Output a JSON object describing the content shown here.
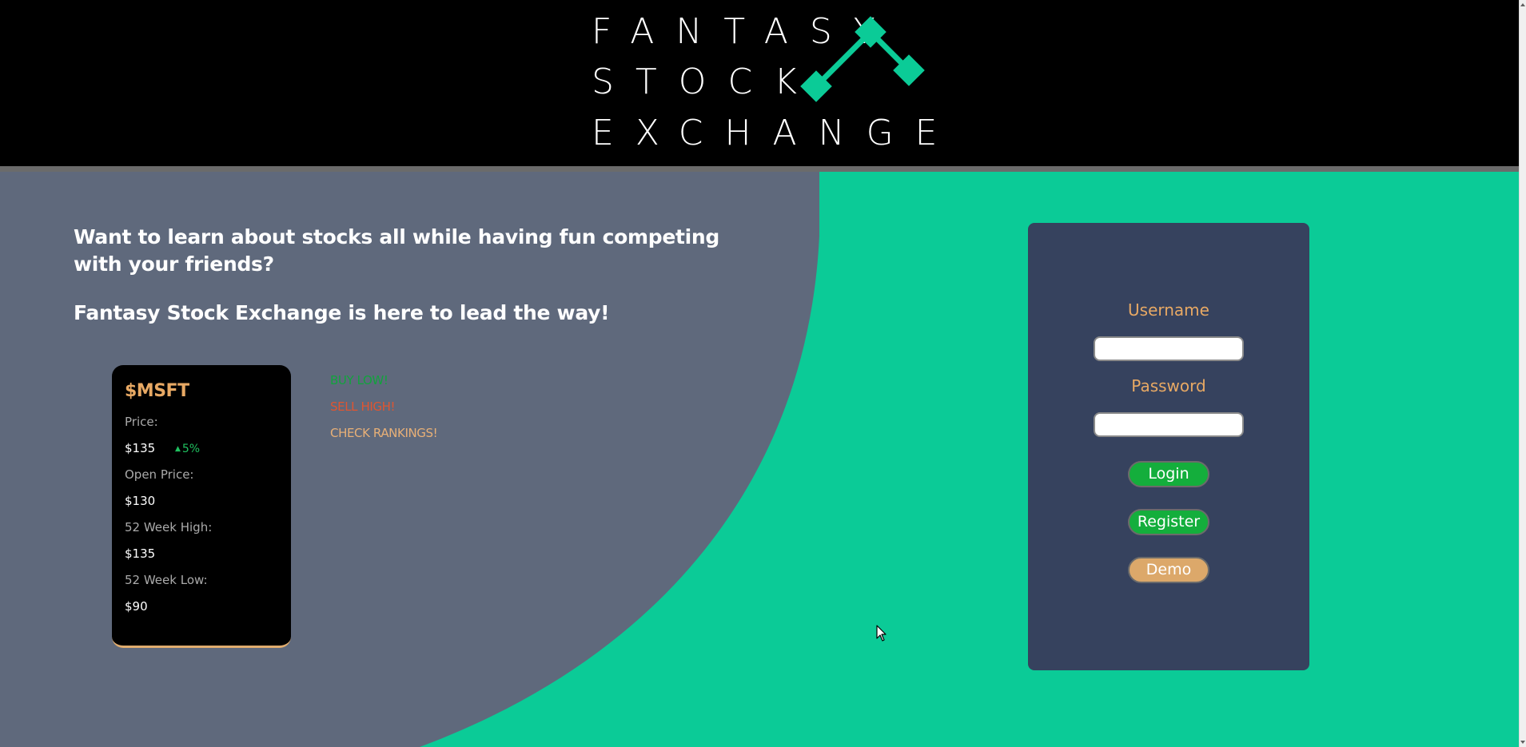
{
  "header": {
    "logo_line1": "FANTASY",
    "logo_line2": "STOCK",
    "logo_line3": "EXCHANGE",
    "logo_color": "#0bcb97"
  },
  "intro": {
    "headline": "Want to learn about stocks all while having fun competing with your friends?",
    "subheadline": "Fantasy Stock Exchange is here to lead the way!"
  },
  "stock_card": {
    "ticker": "$MSFT",
    "price_label": "Price:",
    "price_value": "$135",
    "change": "5%",
    "change_direction": "up",
    "open_label": "Open Price:",
    "open_value": "$130",
    "high_label": "52 Week High:",
    "high_value": "$135",
    "low_label": "52 Week Low:",
    "low_value": "$90"
  },
  "slogans": {
    "buy": "BUY LOW!",
    "sell": "SELL HIGH!",
    "check": "CHECK RANKINGS!"
  },
  "login": {
    "username_label": "Username",
    "username_value": "",
    "password_label": "Password",
    "password_value": "",
    "login_button": "Login",
    "register_button": "Register",
    "demo_button": "Demo"
  },
  "colors": {
    "accent_green": "#0bcb97",
    "left_panel": "#5f697c",
    "login_panel": "#36425e",
    "button_green": "#14ae3c",
    "demo_button": "#dca86a",
    "label_orange": "#e8a964"
  }
}
